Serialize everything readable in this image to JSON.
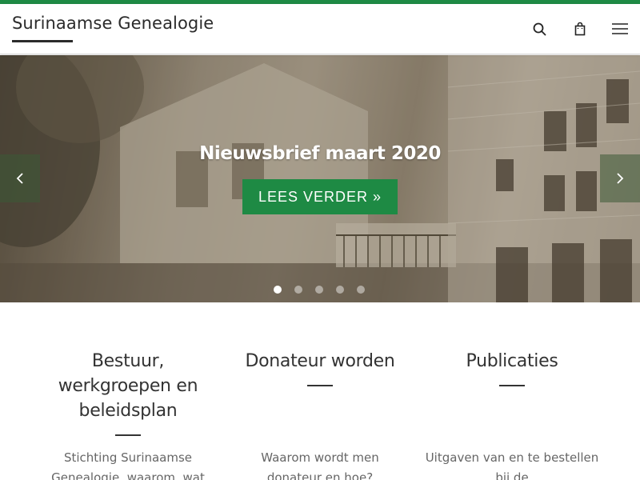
{
  "header": {
    "site_title": "Surinaamse Genealogie",
    "icons": [
      "search-icon",
      "shopping-bag-icon",
      "hamburger-menu-icon"
    ]
  },
  "hero": {
    "title": "Nieuwsbrief maart 2020",
    "button_label": "LEES VERDER »",
    "slides_total": 5,
    "active_slide": 1,
    "icons": [
      "chevron-left-icon",
      "chevron-right-icon"
    ]
  },
  "columns": [
    {
      "title": "Bestuur, werkgroepen en beleidsplan",
      "text": "Stichting Surinaamse Genealogie, waarom, wat"
    },
    {
      "title": "Donateur worden",
      "text": "Waarom wordt men donateur en hoe?"
    },
    {
      "title": "Publicaties",
      "text": "Uitgaven van en te bestellen bij de"
    }
  ],
  "colors": {
    "accent_green": "#1e8a44",
    "text_dark": "#333333",
    "text_muted": "#666666"
  }
}
